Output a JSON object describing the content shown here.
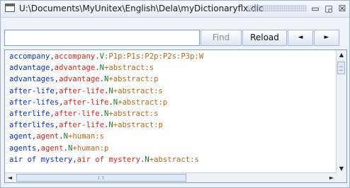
{
  "window": {
    "title": "U:\\Documents\\MyUnitex\\English\\Dela\\myDictionaryflx.dic",
    "controls": {
      "iconify": "▭",
      "maximize": "◲",
      "close": "☒"
    }
  },
  "toolbar": {
    "search_value": "",
    "find_label": "Find",
    "reload_label": "Reload",
    "prev_label": "◄",
    "next_label": "►"
  },
  "scrollbars": {
    "up": "▲",
    "down": "▼",
    "left": "◄",
    "right": "►"
  },
  "entries": [
    {
      "word": "accompany",
      "lemma": "accompany",
      "code": "V:P1p:P1s:P2p:P2s:P3p:W"
    },
    {
      "word": "advantage",
      "lemma": "advantage",
      "code": "N+abstract:s"
    },
    {
      "word": "advantages",
      "lemma": "advantage",
      "code": "N+abstract:p"
    },
    {
      "word": "after-life",
      "lemma": "after-life",
      "code": "N+abstract:s"
    },
    {
      "word": "after-lifes",
      "lemma": "after-life",
      "code": "N+abstract:p"
    },
    {
      "word": "afterlife",
      "lemma": "after-life",
      "code": "N+abstract:s"
    },
    {
      "word": "afterlifes",
      "lemma": "after-life",
      "code": "N+abstract:p"
    },
    {
      "word": "agent",
      "lemma": "agent",
      "code": "N+human:s"
    },
    {
      "word": "agents",
      "lemma": "agent",
      "code": "N+human:p"
    },
    {
      "word": "air of mystery",
      "lemma": "air of mystery",
      "code": "N+abstract:s"
    }
  ],
  "colors": {
    "word": "#0b2fcf",
    "lemma": "#d9221c",
    "category": "#1f7a2a",
    "semantic": "#b8691a"
  }
}
